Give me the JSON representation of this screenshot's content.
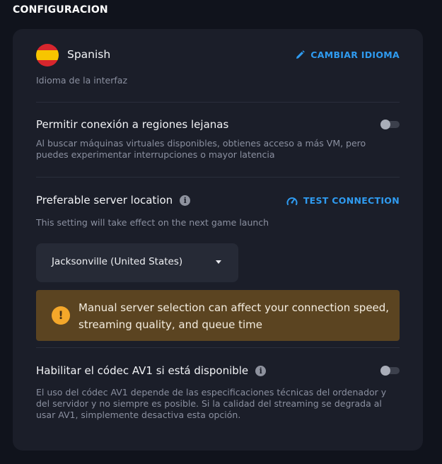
{
  "page": {
    "title": "CONFIGURACION"
  },
  "language": {
    "name": "Spanish",
    "flag_icon": "spain-flag-icon",
    "description": "Idioma de la interfaz",
    "change_label": "CAMBIAR IDIOMA",
    "change_icon": "pencil-icon"
  },
  "far_regions": {
    "title": "Permitir conexión a regiones lejanas",
    "description": "Al buscar máquinas virtuales disponibles, obtienes acceso a más VM, pero puedes experimentar interrupciones o mayor latencia",
    "enabled": false
  },
  "server_location": {
    "title": "Preferable server location",
    "info_icon": "info-icon",
    "test_label": "TEST CONNECTION",
    "test_icon": "speedometer-icon",
    "description": "This setting will take effect on the next game launch",
    "selected": "Jacksonville (United States)",
    "warning_icon": "exclamation-icon",
    "warning": "Manual server selection can affect your connection speed, streaming quality, and queue time"
  },
  "av1": {
    "title": "Habilitar el códec AV1 si está disponible",
    "info_icon": "info-icon",
    "description": "El uso del códec AV1 depende de las especificaciones técnicas del ordenador y del servidor y no siempre es posible. Si la calidad del streaming se degrada al usar AV1, simplemente desactiva esta opción.",
    "enabled": false
  },
  "colors": {
    "background": "#10131c",
    "card": "#1b1e29",
    "accent": "#2f9bf0",
    "warning_bg": "#5b4421",
    "warning_icon": "#f4a72a"
  }
}
